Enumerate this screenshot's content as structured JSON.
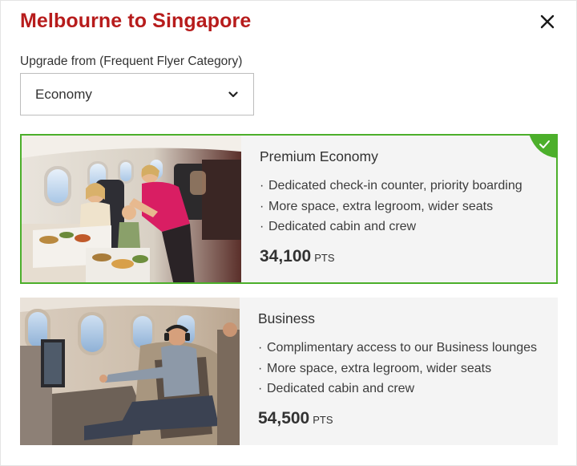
{
  "modal": {
    "title": "Melbourne to Singapore",
    "close_icon": "close-icon"
  },
  "upgrade": {
    "label": "Upgrade from (Frequent Flyer Category)",
    "selected": "Economy",
    "chevron_icon": "chevron-down-icon"
  },
  "options": [
    {
      "title": "Premium Economy",
      "selected": true,
      "features": [
        "Dedicated check-in counter, priority boarding",
        "More space, extra legroom, wider seats",
        "Dedicated cabin and crew"
      ],
      "points": "34,100",
      "points_unit": "PTS"
    },
    {
      "title": "Business",
      "selected": false,
      "features": [
        "Complimentary access to our Business lounges",
        "More space, extra legroom, wider seats",
        "Dedicated cabin and crew"
      ],
      "points": "54,500",
      "points_unit": "PTS"
    }
  ],
  "colors": {
    "title_red": "#b71c1c",
    "selected_green": "#4caf2b",
    "card_bg": "#f4f4f4"
  }
}
